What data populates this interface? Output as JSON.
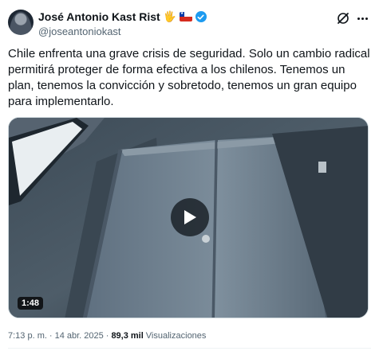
{
  "author": {
    "display_name": "José Antonio Kast Rist",
    "hand_emoji": "🖐",
    "handle": "@joseantoniokast",
    "verified": true,
    "avatar_icon": "avatar-portrait-icon"
  },
  "tweet": {
    "text": "Chile enfrenta una grave crisis de seguridad. Solo un cambio radical permitirá proteger de forma efectiva a los chilenos. Tenemos un plan, tenemos la convicción y sobretodo, tenemos un gran equipo para implementarlo."
  },
  "media": {
    "type": "video",
    "duration": "1:48"
  },
  "footer": {
    "time": "7:13 p. m.",
    "separator_1": "·",
    "date": "14 abr. 2025",
    "separator_2": "·",
    "views_count": "89,3 mil",
    "views_label": "Visualizaciones"
  },
  "colors": {
    "verified": "#1d9bf0",
    "text": "#0f1419",
    "secondary_text": "#536471",
    "flag_red": "#d52b1e",
    "flag_blue": "#0039a6"
  }
}
